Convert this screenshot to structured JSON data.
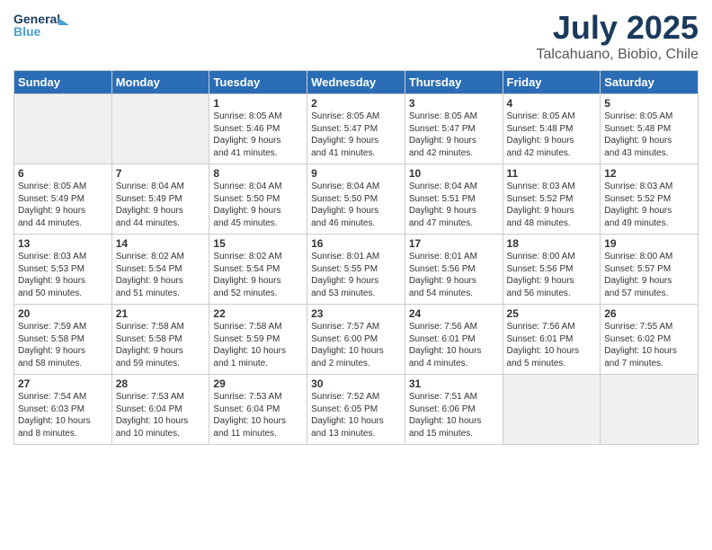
{
  "header": {
    "logo_line1": "General",
    "logo_line2": "Blue",
    "title": "July 2025",
    "location": "Talcahuano, Biobio, Chile"
  },
  "columns": [
    "Sunday",
    "Monday",
    "Tuesday",
    "Wednesday",
    "Thursday",
    "Friday",
    "Saturday"
  ],
  "weeks": [
    [
      {
        "day": "",
        "info": "",
        "empty": true
      },
      {
        "day": "",
        "info": "",
        "empty": true
      },
      {
        "day": "1",
        "info": "Sunrise: 8:05 AM\nSunset: 5:46 PM\nDaylight: 9 hours\nand 41 minutes."
      },
      {
        "day": "2",
        "info": "Sunrise: 8:05 AM\nSunset: 5:47 PM\nDaylight: 9 hours\nand 41 minutes."
      },
      {
        "day": "3",
        "info": "Sunrise: 8:05 AM\nSunset: 5:47 PM\nDaylight: 9 hours\nand 42 minutes."
      },
      {
        "day": "4",
        "info": "Sunrise: 8:05 AM\nSunset: 5:48 PM\nDaylight: 9 hours\nand 42 minutes."
      },
      {
        "day": "5",
        "info": "Sunrise: 8:05 AM\nSunset: 5:48 PM\nDaylight: 9 hours\nand 43 minutes."
      }
    ],
    [
      {
        "day": "6",
        "info": "Sunrise: 8:05 AM\nSunset: 5:49 PM\nDaylight: 9 hours\nand 44 minutes."
      },
      {
        "day": "7",
        "info": "Sunrise: 8:04 AM\nSunset: 5:49 PM\nDaylight: 9 hours\nand 44 minutes."
      },
      {
        "day": "8",
        "info": "Sunrise: 8:04 AM\nSunset: 5:50 PM\nDaylight: 9 hours\nand 45 minutes."
      },
      {
        "day": "9",
        "info": "Sunrise: 8:04 AM\nSunset: 5:50 PM\nDaylight: 9 hours\nand 46 minutes."
      },
      {
        "day": "10",
        "info": "Sunrise: 8:04 AM\nSunset: 5:51 PM\nDaylight: 9 hours\nand 47 minutes."
      },
      {
        "day": "11",
        "info": "Sunrise: 8:03 AM\nSunset: 5:52 PM\nDaylight: 9 hours\nand 48 minutes."
      },
      {
        "day": "12",
        "info": "Sunrise: 8:03 AM\nSunset: 5:52 PM\nDaylight: 9 hours\nand 49 minutes."
      }
    ],
    [
      {
        "day": "13",
        "info": "Sunrise: 8:03 AM\nSunset: 5:53 PM\nDaylight: 9 hours\nand 50 minutes."
      },
      {
        "day": "14",
        "info": "Sunrise: 8:02 AM\nSunset: 5:54 PM\nDaylight: 9 hours\nand 51 minutes."
      },
      {
        "day": "15",
        "info": "Sunrise: 8:02 AM\nSunset: 5:54 PM\nDaylight: 9 hours\nand 52 minutes."
      },
      {
        "day": "16",
        "info": "Sunrise: 8:01 AM\nSunset: 5:55 PM\nDaylight: 9 hours\nand 53 minutes."
      },
      {
        "day": "17",
        "info": "Sunrise: 8:01 AM\nSunset: 5:56 PM\nDaylight: 9 hours\nand 54 minutes."
      },
      {
        "day": "18",
        "info": "Sunrise: 8:00 AM\nSunset: 5:56 PM\nDaylight: 9 hours\nand 56 minutes."
      },
      {
        "day": "19",
        "info": "Sunrise: 8:00 AM\nSunset: 5:57 PM\nDaylight: 9 hours\nand 57 minutes."
      }
    ],
    [
      {
        "day": "20",
        "info": "Sunrise: 7:59 AM\nSunset: 5:58 PM\nDaylight: 9 hours\nand 58 minutes."
      },
      {
        "day": "21",
        "info": "Sunrise: 7:58 AM\nSunset: 5:58 PM\nDaylight: 9 hours\nand 59 minutes."
      },
      {
        "day": "22",
        "info": "Sunrise: 7:58 AM\nSunset: 5:59 PM\nDaylight: 10 hours\nand 1 minute."
      },
      {
        "day": "23",
        "info": "Sunrise: 7:57 AM\nSunset: 6:00 PM\nDaylight: 10 hours\nand 2 minutes."
      },
      {
        "day": "24",
        "info": "Sunrise: 7:56 AM\nSunset: 6:01 PM\nDaylight: 10 hours\nand 4 minutes."
      },
      {
        "day": "25",
        "info": "Sunrise: 7:56 AM\nSunset: 6:01 PM\nDaylight: 10 hours\nand 5 minutes."
      },
      {
        "day": "26",
        "info": "Sunrise: 7:55 AM\nSunset: 6:02 PM\nDaylight: 10 hours\nand 7 minutes."
      }
    ],
    [
      {
        "day": "27",
        "info": "Sunrise: 7:54 AM\nSunset: 6:03 PM\nDaylight: 10 hours\nand 8 minutes."
      },
      {
        "day": "28",
        "info": "Sunrise: 7:53 AM\nSunset: 6:04 PM\nDaylight: 10 hours\nand 10 minutes."
      },
      {
        "day": "29",
        "info": "Sunrise: 7:53 AM\nSunset: 6:04 PM\nDaylight: 10 hours\nand 11 minutes."
      },
      {
        "day": "30",
        "info": "Sunrise: 7:52 AM\nSunset: 6:05 PM\nDaylight: 10 hours\nand 13 minutes."
      },
      {
        "day": "31",
        "info": "Sunrise: 7:51 AM\nSunset: 6:06 PM\nDaylight: 10 hours\nand 15 minutes."
      },
      {
        "day": "",
        "info": "",
        "empty": true
      },
      {
        "day": "",
        "info": "",
        "empty": true
      }
    ]
  ]
}
